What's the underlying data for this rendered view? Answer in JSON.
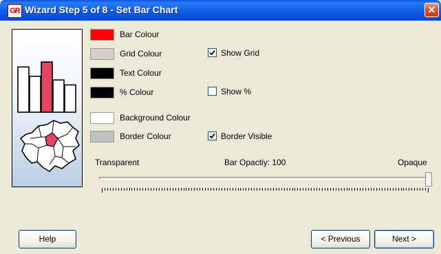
{
  "window": {
    "title": "Wizard Step 5 of 8 - Set Bar Chart",
    "app_icon_text": "GR",
    "close_glyph": "✕",
    "title_bar_color": "#0a5ae6"
  },
  "illustration": {
    "bar_values": [
      0.73,
      0.58,
      0.81,
      0.52,
      0.44
    ],
    "highlighted_bar_index": 2,
    "bar_color": "#e0445e",
    "highlight_region_color": "#e0445e"
  },
  "colours": [
    {
      "id": "bar",
      "label": "Bar Colour",
      "color": "#ff0000"
    },
    {
      "id": "grid",
      "label": "Grid Colour",
      "color": "#d4d0c8"
    },
    {
      "id": "text",
      "label": "Text Colour",
      "color": "#000000"
    },
    {
      "id": "percent",
      "label": "% Colour",
      "color": "#000000"
    },
    {
      "id": "background",
      "label": "Background Colour",
      "color": "#ffffff"
    },
    {
      "id": "border",
      "label": "Border Colour",
      "color": "#c0c0c0"
    }
  ],
  "options": {
    "show_grid": {
      "label": "Show Grid",
      "checked": true
    },
    "show_percent": {
      "label": "Show %",
      "checked": false
    },
    "border_visible": {
      "label": "Border Visible",
      "checked": true
    }
  },
  "opacity": {
    "min_label": "Transparent",
    "max_label": "Opaque",
    "value_label": "Bar Opactiy: 100",
    "value": 100
  },
  "buttons": {
    "help": "Help",
    "previous": "< Previous",
    "next": "Next >"
  }
}
